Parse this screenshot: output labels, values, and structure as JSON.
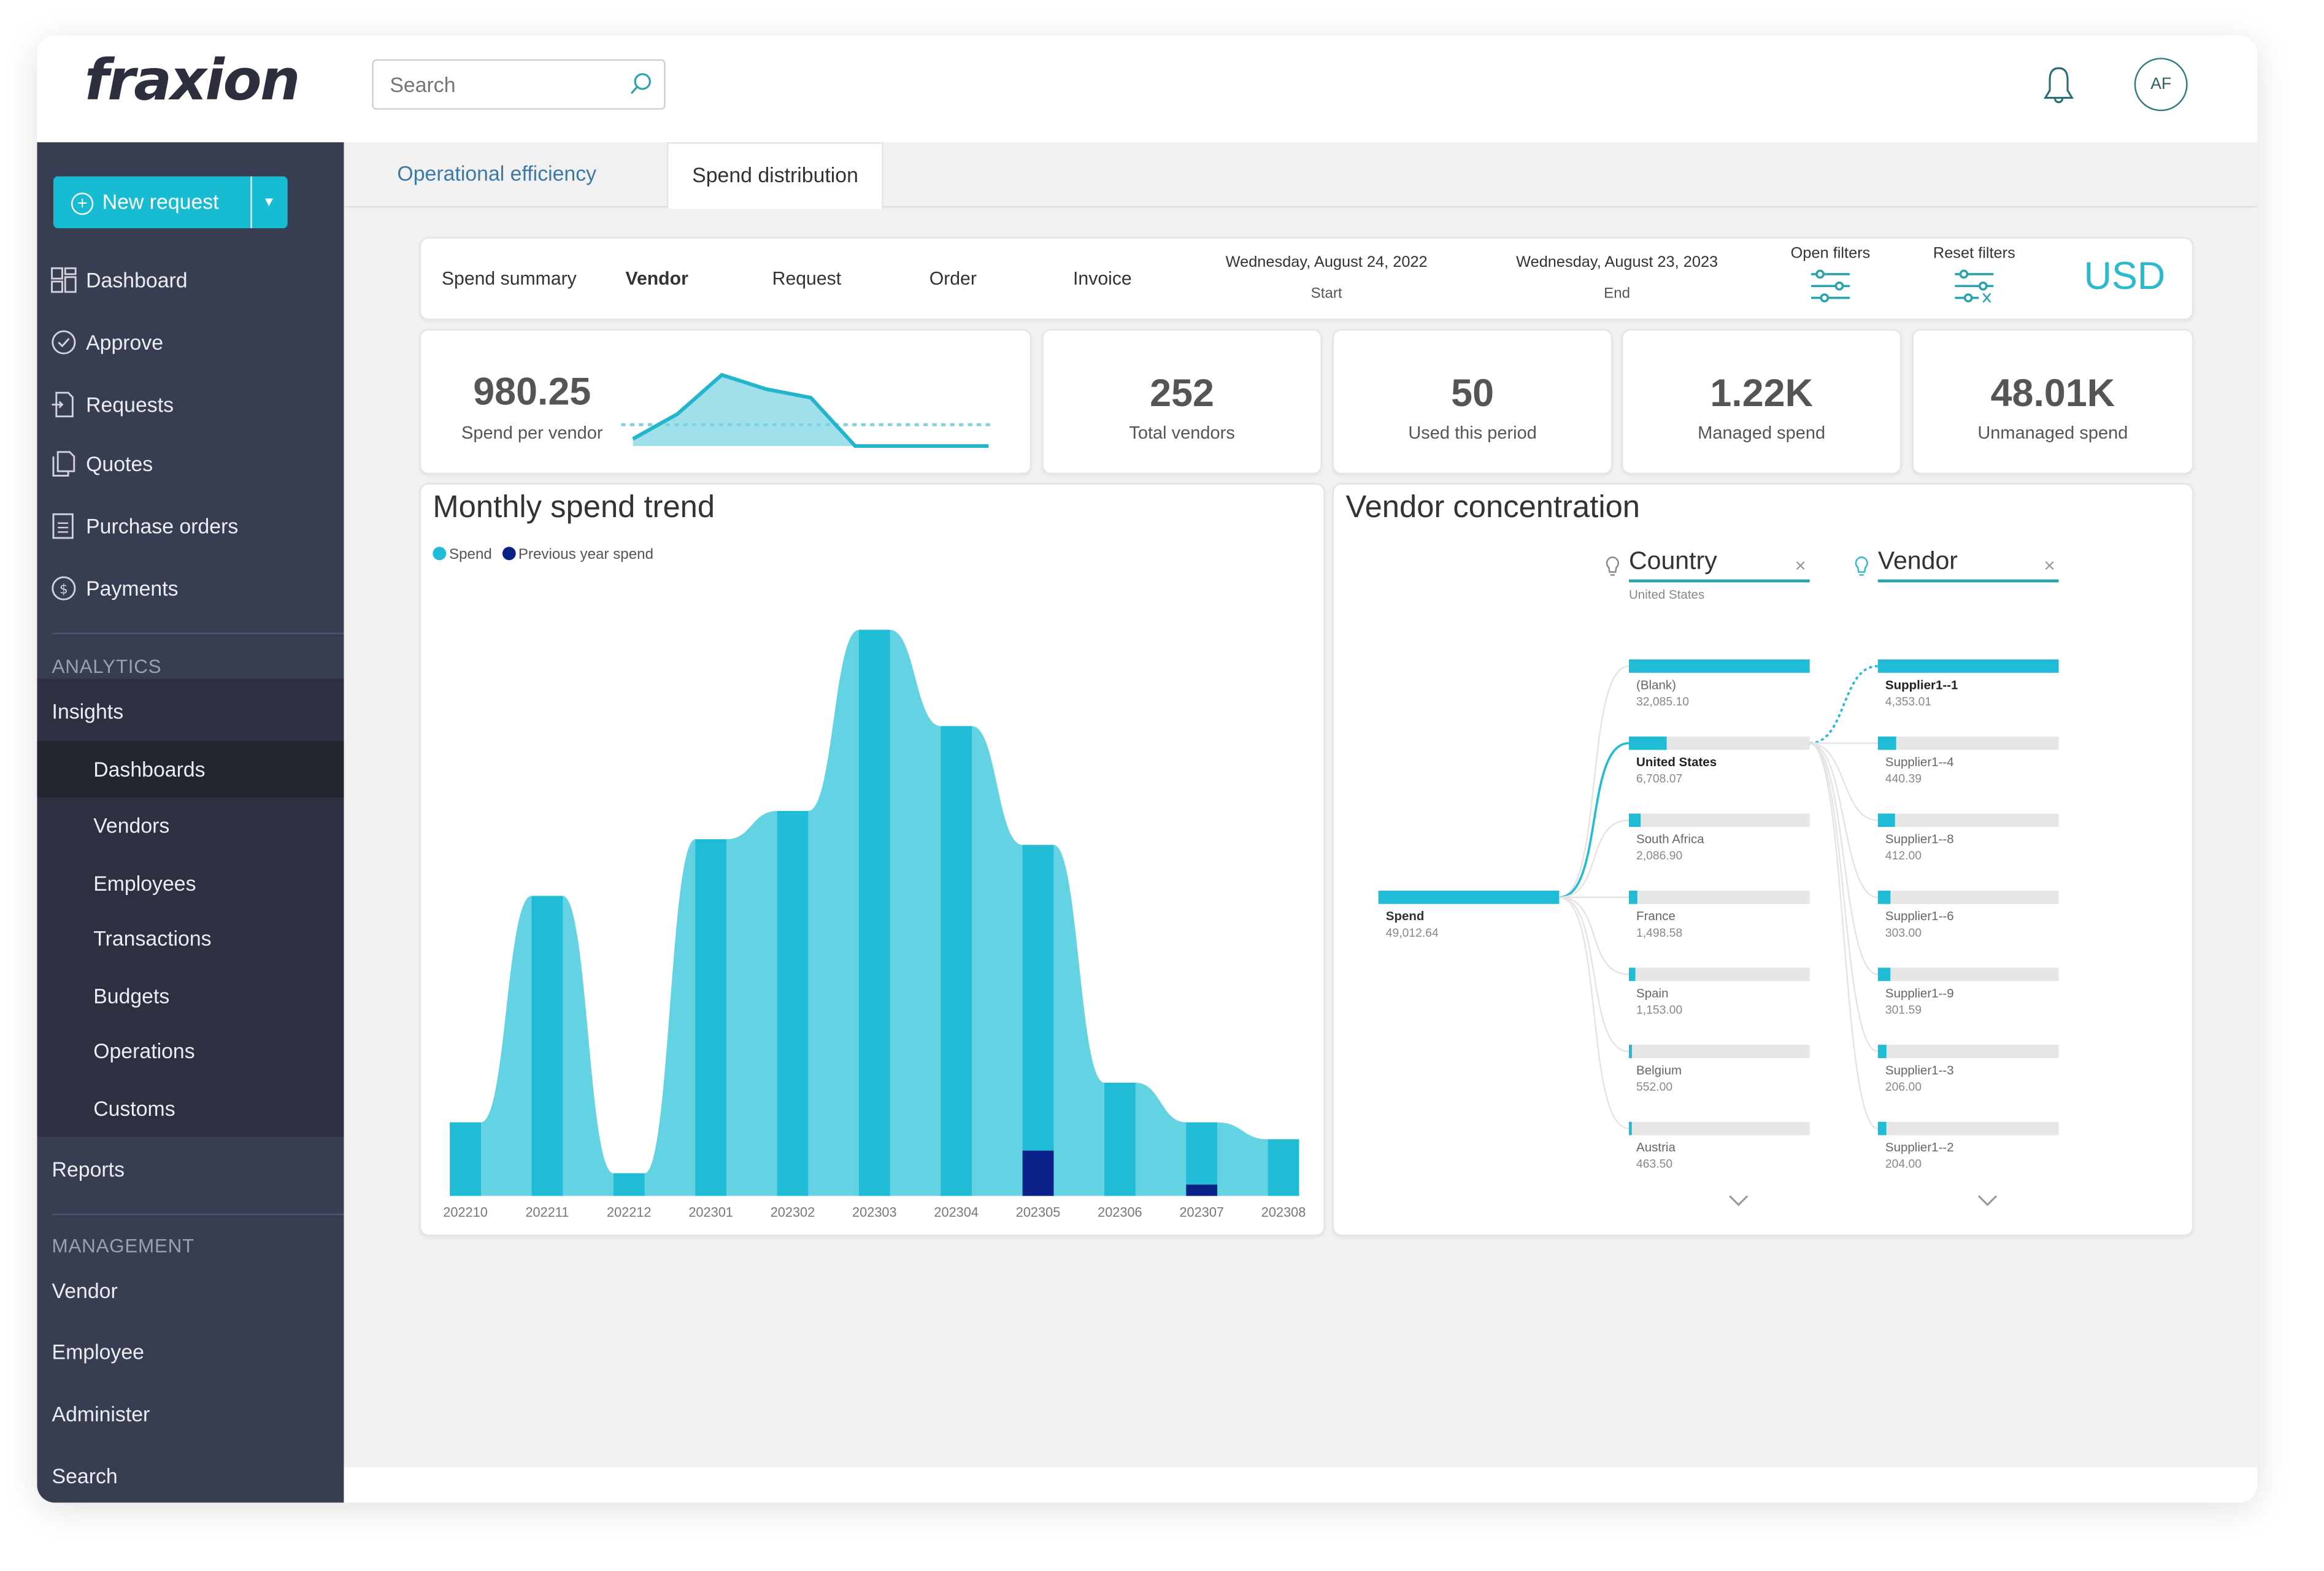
{
  "app": {
    "logo_text": "fraxion",
    "search": {
      "placeholder": "Search",
      "value": ""
    },
    "user_initials": "AF",
    "icons": {
      "search": "search-icon",
      "notifications": "bell-icon"
    }
  },
  "sidebar": {
    "new_request_label": "New request",
    "main_items": [
      {
        "label": "Dashboard",
        "icon": "dashboard-icon"
      },
      {
        "label": "Approve",
        "icon": "check-circle-icon"
      },
      {
        "label": "Requests",
        "icon": "request-doc-icon"
      },
      {
        "label": "Quotes",
        "icon": "copy-doc-icon"
      },
      {
        "label": "Purchase orders",
        "icon": "list-doc-icon"
      },
      {
        "label": "Payments",
        "icon": "dollar-circle-icon"
      }
    ],
    "analytics_heading": "ANALYTICS",
    "insights_label": "Insights",
    "insights_items": [
      {
        "label": "Dashboards",
        "active": true
      },
      {
        "label": "Vendors"
      },
      {
        "label": "Employees"
      },
      {
        "label": "Transactions"
      },
      {
        "label": "Budgets"
      },
      {
        "label": "Operations"
      },
      {
        "label": "Customs"
      }
    ],
    "reports_label": "Reports",
    "management_heading": "MANAGEMENT",
    "management_items": [
      {
        "label": "Vendor"
      },
      {
        "label": "Employee"
      },
      {
        "label": "Administer"
      },
      {
        "label": "Search"
      }
    ]
  },
  "tabs": [
    {
      "label": "Operational efficiency",
      "active": false
    },
    {
      "label": "Spend distribution",
      "active": true
    }
  ],
  "filter_bar": {
    "nav": [
      {
        "label": "Spend summary",
        "active": false
      },
      {
        "label": "Vendor",
        "active": true
      },
      {
        "label": "Request",
        "active": false
      },
      {
        "label": "Order",
        "active": false
      },
      {
        "label": "Invoice",
        "active": false
      }
    ],
    "start_date": "Wednesday, August 24, 2022",
    "start_label": "Start",
    "end_date": "Wednesday, August 23, 2023",
    "end_label": "End",
    "open_filters_label": "Open filters",
    "reset_filters_label": "Reset filters",
    "currency": "USD"
  },
  "kpis": [
    {
      "value": "980.25",
      "label": "Spend per vendor"
    },
    {
      "value": "252",
      "label": "Total vendors"
    },
    {
      "value": "50",
      "label": "Used this period"
    },
    {
      "value": "1.22K",
      "label": "Managed spend"
    },
    {
      "value": "48.01K",
      "label": "Unmanaged spend"
    }
  ],
  "sparkline": {
    "values": [
      0.1,
      0.45,
      1.0,
      0.8,
      0.68,
      0.0,
      0.0,
      0.0,
      0.0
    ],
    "average": 0.3
  },
  "colors": {
    "accent": "#20bcd6",
    "accent_light": "#63d3e3",
    "previous_year": "#0a2287",
    "sidebar_bg": "#383d52"
  },
  "chart_data": [
    {
      "type": "area",
      "title": "Monthly spend trend",
      "xlabel": "",
      "ylabel": "",
      "legend_position": "top-left",
      "grid": false,
      "categories": [
        "202210",
        "202211",
        "202212",
        "202301",
        "202302",
        "202303",
        "202304",
        "202305",
        "202306",
        "202307",
        "202308"
      ],
      "ylim": [
        0,
        1
      ],
      "y_units": "relative (axis unlabeled)",
      "series": [
        {
          "name": "Spend",
          "color": "#20bcd6",
          "values": [
            0.13,
            0.53,
            0.04,
            0.63,
            0.68,
            1.0,
            0.83,
            0.62,
            0.2,
            0.13,
            0.1
          ]
        },
        {
          "name": "Previous year spend",
          "color": "#0a2287",
          "values": [
            0,
            0,
            0,
            0,
            0,
            0,
            0,
            0.08,
            0,
            0.02,
            0
          ]
        }
      ]
    },
    {
      "type": "bar",
      "title": "Vendor concentration",
      "root": {
        "label": "Spend",
        "value": 49012.64,
        "display": "49,012.64"
      },
      "levels": [
        {
          "name": "Country",
          "selected": "United States",
          "items": [
            {
              "label": "(Blank)",
              "value": 32085.1,
              "display": "32,085.10"
            },
            {
              "label": "United States",
              "value": 6708.07,
              "display": "6,708.07",
              "selected": true
            },
            {
              "label": "South Africa",
              "value": 2086.9,
              "display": "2,086.90"
            },
            {
              "label": "France",
              "value": 1498.58,
              "display": "1,498.58"
            },
            {
              "label": "Spain",
              "value": 1153.0,
              "display": "1,153.00"
            },
            {
              "label": "Belgium",
              "value": 552.0,
              "display": "552.00"
            },
            {
              "label": "Austria",
              "value": 463.5,
              "display": "463.50"
            }
          ]
        },
        {
          "name": "Vendor",
          "items": [
            {
              "label": "Supplier1--1",
              "value": 4353.01,
              "display": "4,353.01",
              "selected": true
            },
            {
              "label": "Supplier1--4",
              "value": 440.39,
              "display": "440.39"
            },
            {
              "label": "Supplier1--8",
              "value": 412.0,
              "display": "412.00"
            },
            {
              "label": "Supplier1--6",
              "value": 303.0,
              "display": "303.00"
            },
            {
              "label": "Supplier1--9",
              "value": 301.59,
              "display": "301.59"
            },
            {
              "label": "Supplier1--3",
              "value": 206.0,
              "display": "206.00"
            },
            {
              "label": "Supplier1--2",
              "value": 204.0,
              "display": "204.00"
            }
          ]
        }
      ]
    }
  ]
}
